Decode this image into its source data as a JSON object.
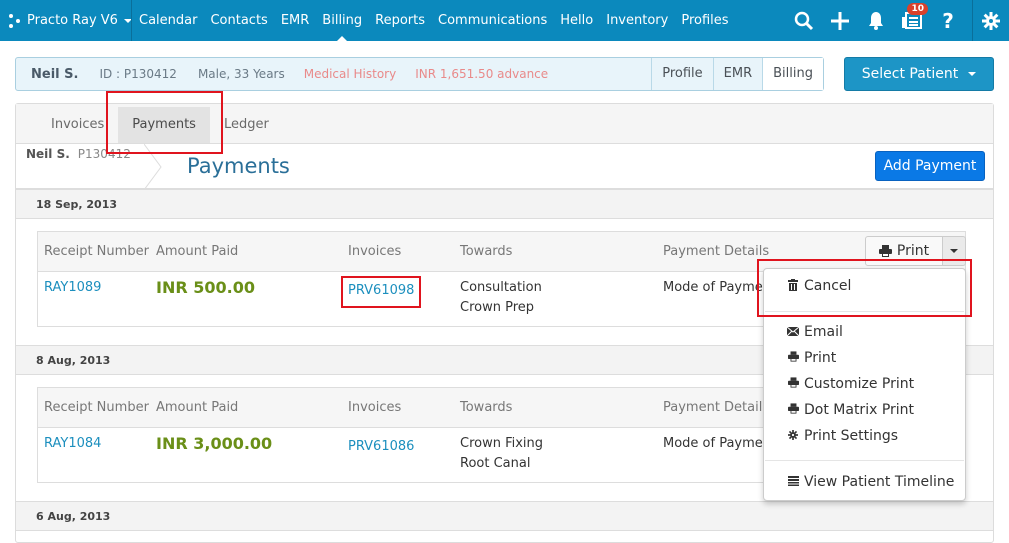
{
  "topnav": {
    "brand": "Practo Ray V6",
    "links": [
      "Calendar",
      "Contacts",
      "EMR",
      "Billing",
      "Reports",
      "Communications",
      "Hello",
      "Inventory",
      "Profiles"
    ],
    "active_link": "Billing",
    "icons": [
      "search-icon",
      "plus-icon",
      "bell-icon",
      "news-icon",
      "help-icon",
      "gear-icon"
    ],
    "notification_count": "10"
  },
  "patient": {
    "name": "Neil S.",
    "id": "ID : P130412",
    "gender_age": "Male, 33 Years",
    "medical_history": "Medical History",
    "advance": "INR 1,651.50 advance",
    "tabs": [
      "Profile",
      "EMR",
      "Billing"
    ],
    "active_tab": "Billing",
    "select_button": "Select Patient"
  },
  "billing": {
    "tabs": [
      "Invoices",
      "Payments",
      "Ledger"
    ],
    "active_tab": "Payments",
    "crumb_name": "Neil S.",
    "crumb_id": "P130412",
    "title": "Payments",
    "add_button": "Add Payment"
  },
  "table_headers": [
    "Receipt Number",
    "Amount Paid",
    "Invoices",
    "Towards",
    "Payment Details"
  ],
  "groups": [
    {
      "date": "18 Sep, 2013",
      "receipt": "RAY1089",
      "amount": "INR 500.00",
      "invoice": "PRV61098",
      "towards": [
        "Consultation",
        "Crown Prep"
      ],
      "details": "Mode of Payment"
    },
    {
      "date": "8 Aug, 2013",
      "receipt": "RAY1084",
      "amount": "INR 3,000.00",
      "invoice": "PRV61086",
      "towards": [
        "Crown Fixing",
        "Root Canal"
      ],
      "details": "Mode of Payment"
    },
    {
      "date": "6 Aug, 2013"
    }
  ],
  "print": {
    "button": "Print",
    "menu": [
      {
        "label": "Cancel",
        "icon": "trash-icon"
      },
      {
        "label": "Email",
        "icon": "envelope-icon"
      },
      {
        "label": "Print",
        "icon": "print-icon"
      },
      {
        "label": "Customize Print",
        "icon": "print-icon"
      },
      {
        "label": "Dot Matrix Print",
        "icon": "print-icon"
      },
      {
        "label": "Print Settings",
        "icon": "cog-icon"
      },
      {
        "label": "View Patient Timeline",
        "icon": "list-icon"
      }
    ]
  }
}
